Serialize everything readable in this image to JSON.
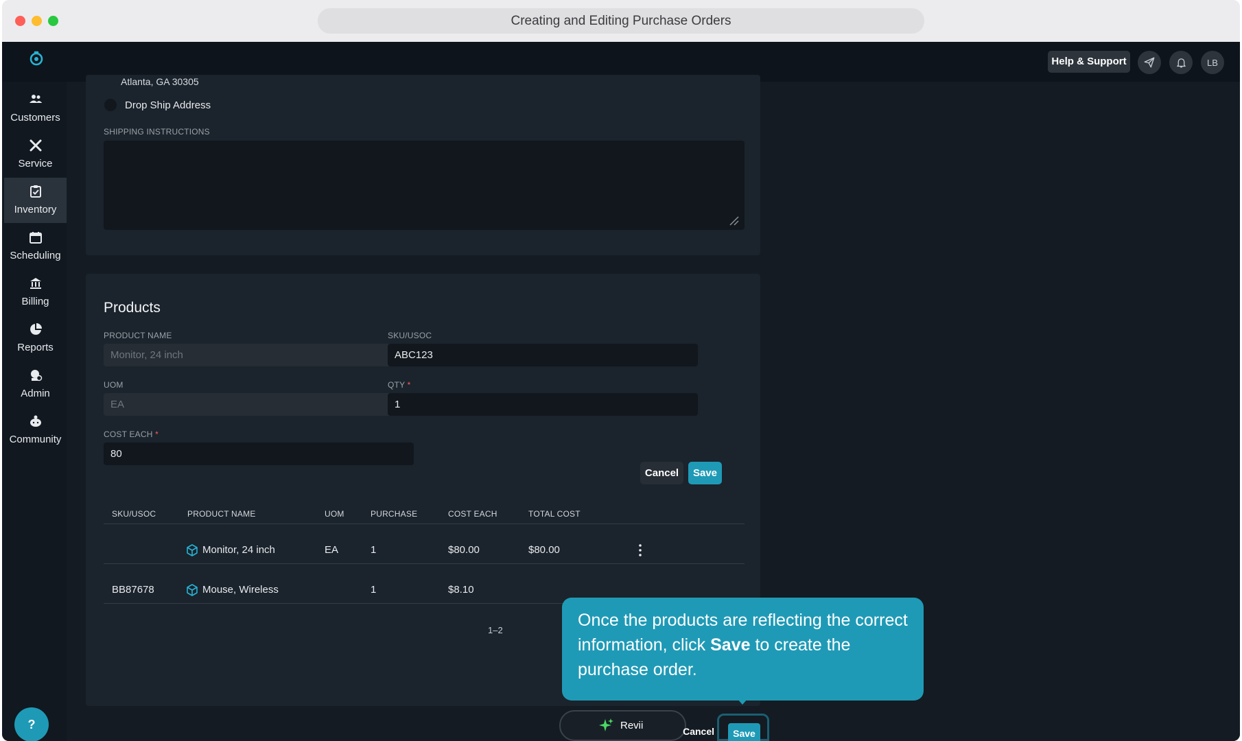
{
  "browser": {
    "title": "Creating and Editing Purchase Orders"
  },
  "topnav": {
    "help_label": "Help & Support",
    "avatar": "LB"
  },
  "sidebar": {
    "items": [
      {
        "label": "Customers",
        "icon": "customers-icon"
      },
      {
        "label": "Service",
        "icon": "service-icon"
      },
      {
        "label": "Inventory",
        "icon": "inventory-icon",
        "active": true
      },
      {
        "label": "Scheduling",
        "icon": "calendar-icon"
      },
      {
        "label": "Billing",
        "icon": "bank-icon"
      },
      {
        "label": "Reports",
        "icon": "pie-chart-icon"
      },
      {
        "label": "Admin",
        "icon": "admin-icon"
      },
      {
        "label": "Community",
        "icon": "community-icon"
      }
    ],
    "help_fab": "?"
  },
  "shipping": {
    "address_line": "Atlanta, GA 30305",
    "drop_ship_label": "Drop Ship Address",
    "instructions_label": "SHIPPING INSTRUCTIONS",
    "instructions_value": ""
  },
  "products": {
    "title": "Products",
    "form": {
      "product_name_label": "PRODUCT NAME",
      "product_name_value": "Monitor, 24 inch",
      "sku_label": "SKU/USOC",
      "sku_value": "ABC123",
      "uom_label": "UOM",
      "uom_value": "EA",
      "qty_label": "QTY",
      "qty_value": "1",
      "cost_label": "COST EACH",
      "cost_value": "80",
      "required_mark": "*",
      "cancel_label": "Cancel",
      "save_label": "Save"
    },
    "table": {
      "headers": [
        "SKU/USOC",
        "PRODUCT NAME",
        "UOM",
        "PURCHASE",
        "COST EACH",
        "TOTAL COST"
      ],
      "rows": [
        {
          "sku": "",
          "name": "Monitor, 24 inch",
          "uom": "EA",
          "purchase": "1",
          "cost": "$80.00",
          "total": "$80.00"
        },
        {
          "sku": "BB87678",
          "name": "Mouse, Wireless",
          "uom": "",
          "purchase": "1",
          "cost": "$8.10",
          "total": ""
        }
      ],
      "pager": "1–2"
    }
  },
  "tooltip": {
    "text_before": "Once the products are reflecting the correct information, click ",
    "text_bold": "Save",
    "text_after": " to create the purchase order."
  },
  "bottom_bar": {
    "revii_label": "Revii",
    "cancel_label": "Cancel",
    "save_label": "Save"
  },
  "colors": {
    "accent": "#1f9ab6",
    "background": "#141b22",
    "card": "#1b232c"
  }
}
